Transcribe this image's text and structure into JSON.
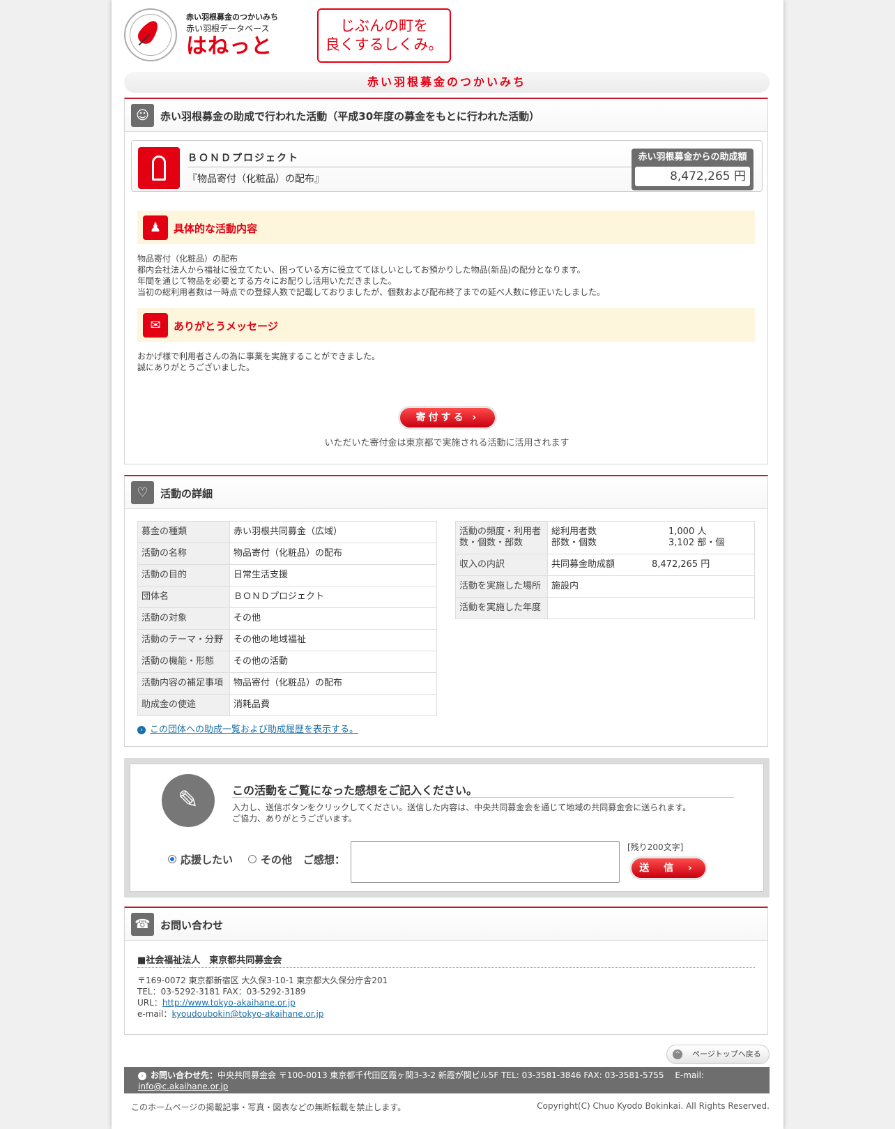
{
  "header": {
    "logo_line1": "赤い羽根募金のつかいみち",
    "logo_line2": "赤い羽根データベース",
    "logo_brand": "はねっと",
    "slogan_line1": "じぶんの町を",
    "slogan_line2": "良くするしくみ。",
    "page_title": "赤い羽根募金のつかいみち"
  },
  "activity": {
    "heading": "赤い羽根募金の助成で行われた活動（平成30年度の募金をもとに行われた活動）",
    "project_name": "ＢＯＮＤプロジェクト",
    "project_desc": "『物品寄付（化粧品）の配布』",
    "grant_label": "赤い羽根募金からの助成額",
    "grant_value": "8,472,265 円",
    "content_title": "具体的な活動内容",
    "content_lines": [
      "物品寄付（化粧品）の配布",
      "都内会社法人から福祉に役立てたい、困っている方に役立ててほしいとしてお預かりした物品(新品)の配分となります。",
      "年間を通じて物品を必要とする方々にお配りし活用いただきました。",
      "当初の総利用者数は一時点での登録人数で記載しておりましたが、個数および配布終了までの延べ人数に修正いたしました。"
    ],
    "thanks_title": "ありがとうメッセージ",
    "thanks_lines": [
      "おかげ様で利用者さんの為に事業を実施することができました。",
      "誠にありがとうございました。"
    ],
    "donate_label": "寄付する ›",
    "donate_note": "いただいた寄付金は東京都で実施される活動に活用されます"
  },
  "details": {
    "heading": "活動の詳細",
    "left": [
      {
        "k": "募金の種類",
        "v": "赤い羽根共同募金（広域）"
      },
      {
        "k": "活動の名称",
        "v": "物品寄付（化粧品）の配布"
      },
      {
        "k": "活動の目的",
        "v": "日常生活支援"
      },
      {
        "k": "団体名",
        "v": "ＢＯＮＤプロジェクト"
      },
      {
        "k": "活動の対象",
        "v": "その他"
      },
      {
        "k": "活動のテーマ・分野",
        "v": "その他の地域福祉"
      },
      {
        "k": "活動の機能・形態",
        "v": "その他の活動"
      },
      {
        "k": "活動内容の補足事項",
        "v": "物品寄付（化粧品）の配布"
      },
      {
        "k": "助成金の使途",
        "v": "消耗品費"
      }
    ],
    "right": {
      "freq_key_1": "活動の頻度・利用者",
      "freq_key_2": "数・個数・部数",
      "users_label": "総利用者数",
      "users_value": "1,000 人",
      "copies_label": "部数・個数",
      "copies_value": "3,102 部・個",
      "income_key": "収入の内訳",
      "income_label": "共同募金助成額",
      "income_value": "8,472,265 円",
      "place_key": "活動を実施した場所",
      "place_value": "施設内",
      "year_key": "活動を実施した年度",
      "year_value": ""
    },
    "history_link": "この団体への助成一覧および助成履歴を表示する。"
  },
  "feedback": {
    "title": "この活動をご覧になった感想をご記入ください。",
    "desc_line1": "入力し、送信ボタンをクリックしてください。送信した内容は、中央共同募金会を通じて地域の共同募金会に送られます。",
    "desc_line2": "ご協力、ありがとうございます。",
    "option_support": "応援したい",
    "option_other": "その他",
    "comment_label": "ご感想：",
    "remaining": "[残り200文字]",
    "send_label": "送 信 ›"
  },
  "contact": {
    "heading": "お問い合わせ",
    "org": "■社会福祉法人　東京都共同募金会",
    "address": "〒169-0072 東京都新宿区 大久保3-10-1 東京都大久保分庁舎201",
    "tel": "TEL：03-5292-3181 FAX：03-5292-3189",
    "url_label": "URL：",
    "url": "http://www.tokyo-akaihane.or.jp",
    "email_label": "e-mail：",
    "email": "kyoudoubokin@tokyo-akaihane.or.jp"
  },
  "footer": {
    "page_top": "ページトップへ戻る",
    "contact_label": "お問い合わせ先：",
    "contact_text": "中央共同募金会 〒100-0013 東京都千代田区霞ヶ関3-3-2 新霞が関ビル5F TEL: 03-3581-3846 FAX: 03-3581-5755　 E-mail:",
    "contact_email": "info@c.akaihane.or.jp",
    "notice": "このホームページの掲載記事・写真・図表などの無断転載を禁止します。",
    "copyright": "Copyright(C) Chuo Kyodo Bokinkai. All Rights Reserved."
  }
}
